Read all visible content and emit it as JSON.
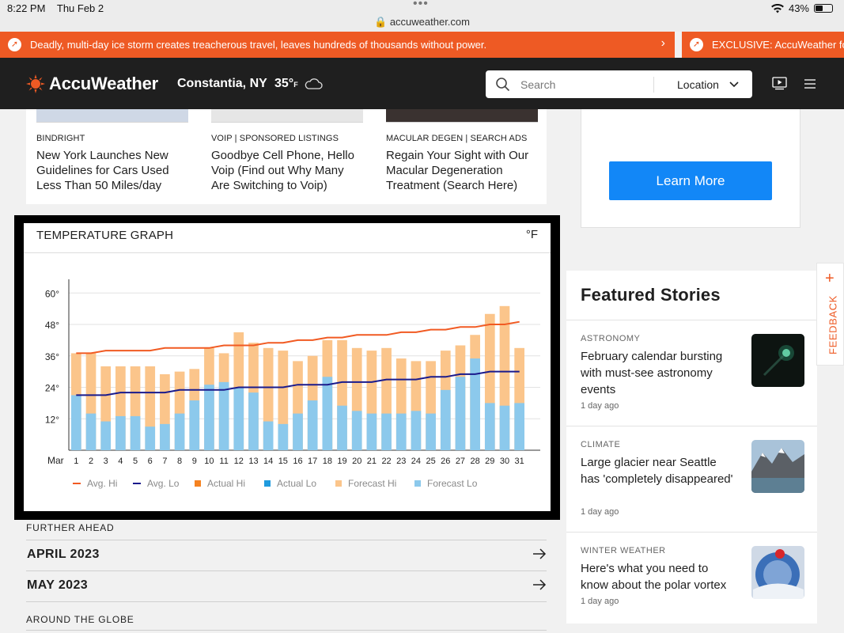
{
  "status_bar": {
    "time": "8:22 PM",
    "date": "Thu Feb 2",
    "url": "accuweather.com",
    "battery": "43%"
  },
  "alerts": [
    {
      "text": "Deadly, multi-day ice storm creates treacherous travel, leaves hundreds of thousands without power."
    },
    {
      "text": "EXCLUSIVE: AccuWeather forecasters"
    }
  ],
  "header": {
    "logo": "AccuWeather",
    "location": "Constantia, NY",
    "temp": "35°",
    "temp_unit": "F",
    "search_placeholder": "Search",
    "location_button": "Location"
  },
  "sponsored": [
    {
      "tag": "BINDRIGHT",
      "title": "New York Launches New Guidelines for Cars Used Less Than 50 Miles/day"
    },
    {
      "tag": "VOIP | SPONSORED LISTINGS",
      "title": "Goodbye Cell Phone, Hello Voip (Find out Why Many Are Switching to Voip)"
    },
    {
      "tag": "MACULAR DEGEN | SEARCH ADS",
      "title": "Regain Your Sight with Our Macular Degeneration Treatment (Search Here)"
    }
  ],
  "ad": {
    "button": "Learn More"
  },
  "temperature_graph": {
    "title": "TEMPERATURE GRAPH",
    "unit": "°F"
  },
  "chart_data": {
    "type": "bar",
    "title": "TEMPERATURE GRAPH",
    "month_label": "Mar",
    "categories": [
      "1",
      "2",
      "3",
      "4",
      "5",
      "6",
      "7",
      "8",
      "9",
      "10",
      "11",
      "12",
      "13",
      "14",
      "15",
      "16",
      "17",
      "18",
      "19",
      "20",
      "21",
      "22",
      "23",
      "24",
      "25",
      "26",
      "27",
      "28",
      "29",
      "30",
      "31"
    ],
    "y_ticks": [
      "12°",
      "24°",
      "36°",
      "48°",
      "60°"
    ],
    "ylim": [
      0,
      64
    ],
    "series": [
      {
        "name": "Avg. Hi",
        "kind": "line",
        "color": "#f15a22",
        "values": [
          37,
          37,
          38,
          38,
          38,
          38,
          39,
          39,
          39,
          39,
          40,
          40,
          40,
          41,
          41,
          42,
          42,
          43,
          43,
          44,
          44,
          44,
          45,
          45,
          46,
          46,
          47,
          47,
          48,
          48,
          49
        ]
      },
      {
        "name": "Avg. Lo",
        "kind": "line",
        "color": "#1a1a8c",
        "values": [
          21,
          21,
          21,
          22,
          22,
          22,
          22,
          23,
          23,
          23,
          23,
          24,
          24,
          24,
          24,
          25,
          25,
          25,
          26,
          26,
          26,
          27,
          27,
          27,
          28,
          28,
          29,
          29,
          30,
          30,
          30
        ]
      },
      {
        "name": "Actual Hi",
        "kind": "bar",
        "color": "#f58220",
        "values": []
      },
      {
        "name": "Actual Lo",
        "kind": "bar",
        "color": "#1f9bde",
        "values": []
      },
      {
        "name": "Forecast Hi",
        "kind": "bar",
        "color": "#fbc58b",
        "values": [
          37,
          37,
          32,
          32,
          32,
          32,
          29,
          30,
          31,
          39,
          37,
          45,
          41,
          39,
          38,
          34,
          36,
          42,
          42,
          39,
          38,
          39,
          35,
          34,
          34,
          38,
          40,
          44,
          52,
          55,
          39
        ]
      },
      {
        "name": "Forecast Lo",
        "kind": "bar",
        "color": "#8cc9ec",
        "values": [
          21,
          14,
          11,
          13,
          13,
          9,
          10,
          14,
          19,
          25,
          26,
          24,
          22,
          11,
          10,
          14,
          19,
          28,
          17,
          15,
          14,
          14,
          14,
          15,
          14,
          23,
          28,
          35,
          18,
          17,
          18
        ]
      }
    ]
  },
  "further_ahead": {
    "heading": "FURTHER AHEAD",
    "months": [
      "APRIL 2023",
      "MAY 2023"
    ],
    "around_globe": "AROUND THE GLOBE"
  },
  "featured": {
    "title": "Featured Stories",
    "stories": [
      {
        "tag": "ASTRONOMY",
        "title": "February calendar bursting with must-see astronomy events",
        "time": "1 day ago"
      },
      {
        "tag": "CLIMATE",
        "title": "Large glacier near Seattle has 'completely disappeared'",
        "time": "1 day ago"
      },
      {
        "tag": "WINTER WEATHER",
        "title": "Here's what you need to know about the polar vortex",
        "time": "1 day ago"
      }
    ]
  },
  "feedback": {
    "label": "FEEDBACK"
  },
  "colors": {
    "accent": "#ee5a24",
    "header_bg": "#1f1f1f",
    "button_blue": "#1287f7"
  }
}
